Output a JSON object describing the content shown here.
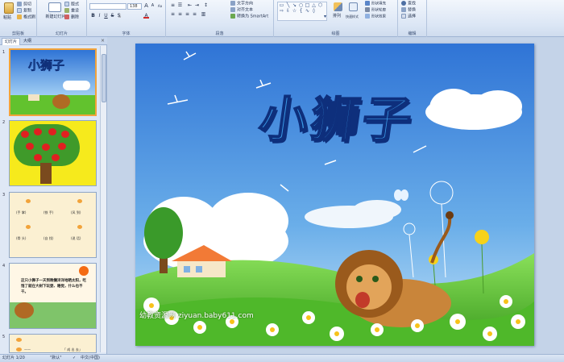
{
  "ribbon": {
    "clipboard": {
      "label": "剪贴板",
      "paste": "粘贴",
      "cut": "剪切",
      "copy": "复制",
      "format_painter": "格式刷"
    },
    "slides": {
      "label": "幻灯片",
      "new_slide": "新建幻灯片",
      "layout": "版式",
      "reset": "重设",
      "delete": "删除"
    },
    "font": {
      "label": "字体",
      "font_name": "",
      "font_size": "138",
      "bold": "B",
      "italic": "I",
      "underline": "U",
      "strike": "S",
      "shadow": "S",
      "grow": "A",
      "shrink": "A",
      "clear": "Aa"
    },
    "paragraph": {
      "label": "段落",
      "text_direction": "文字方向",
      "align_text": "对齐文本",
      "smartart": "转换为 SmartArt"
    },
    "drawing": {
      "label": "绘图",
      "arrange": "排列",
      "quick_styles": "快速样式",
      "shape_fill": "形状填充",
      "shape_outline": "形状轮廓",
      "shape_effects": "形状效果"
    },
    "editing": {
      "label": "编辑",
      "find": "查找",
      "replace": "替换",
      "select": "选择"
    }
  },
  "pane": {
    "tab_slides": "幻灯片",
    "tab_outline": "大纲",
    "close": "×",
    "thumbs": [
      {
        "num": "1",
        "title": "小狮子"
      },
      {
        "num": "2"
      },
      {
        "num": "3",
        "cells": [
          "(手 掌)",
          "(铁 手)",
          "(风 到)",
          "(骨 头)",
          "(自 找)",
          "(说 话)"
        ]
      },
      {
        "num": "4",
        "text": "这只小狮子一天到晚懒洋洋地晒太阳，吃饱了就在大树下玩耍、睡觉，什么也不干。"
      },
      {
        "num": "5",
        "cells": [
          "——",
          "「 成 出 去」"
        ]
      }
    ]
  },
  "slide": {
    "title": "小狮子",
    "watermark": "幼教资源网 ziyuan.baby611.com"
  },
  "status": {
    "slide_pos": "幻灯片 1/20",
    "theme": "\"默认\"",
    "language": "中文(中国)"
  },
  "colors": {
    "sky_top": "#2f74d6",
    "sky_bottom": "#a9d2f5",
    "grass": "#5cc42a",
    "title_fill": "#3a9be8",
    "accent_orange": "#f2a33a"
  }
}
